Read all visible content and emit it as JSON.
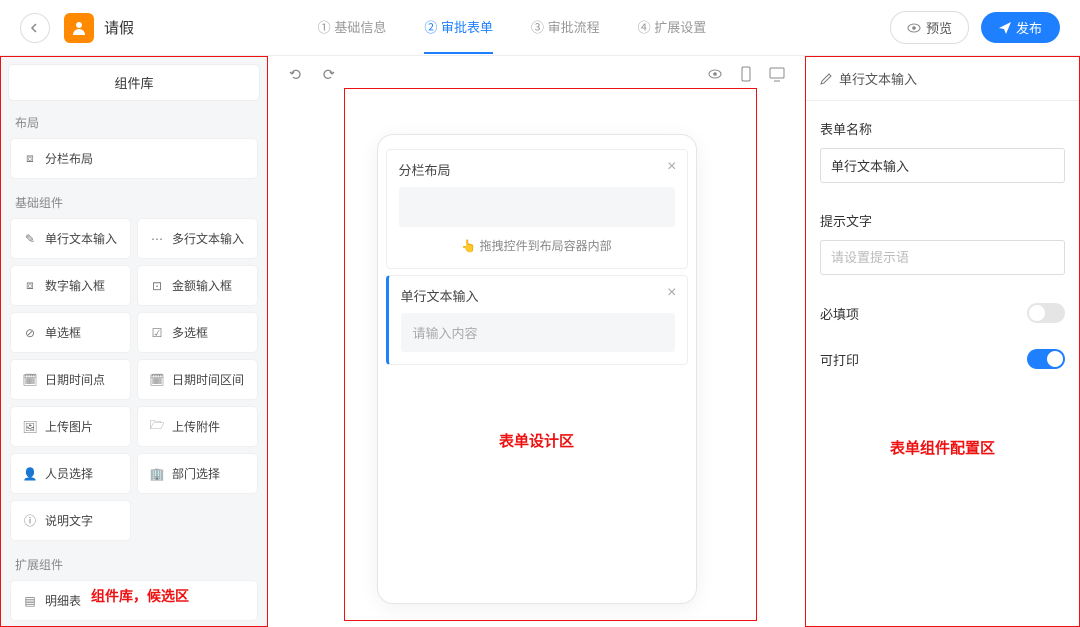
{
  "header": {
    "app_title": "请假",
    "steps": [
      {
        "num": "①",
        "label": "基础信息"
      },
      {
        "num": "②",
        "label": "审批表单"
      },
      {
        "num": "③",
        "label": "审批流程"
      },
      {
        "num": "④",
        "label": "扩展设置"
      }
    ],
    "active_step": 1,
    "preview_label": "预览",
    "publish_label": "发布"
  },
  "library": {
    "title": "组件库",
    "sections": {
      "layout_label": "布局",
      "layout_items": [
        {
          "icon": "⧈",
          "label": "分栏布局"
        }
      ],
      "basic_label": "基础组件",
      "basic_items": [
        {
          "icon": "✎",
          "label": "单行文本输入"
        },
        {
          "icon": "⋯",
          "label": "多行文本输入"
        },
        {
          "icon": "⧈",
          "label": "数字输入框"
        },
        {
          "icon": "⊡",
          "label": "金额输入框"
        },
        {
          "icon": "⊘",
          "label": "单选框"
        },
        {
          "icon": "☑",
          "label": "多选框"
        },
        {
          "icon": "🗓",
          "label": "日期时间点"
        },
        {
          "icon": "🗓",
          "label": "日期时间区间"
        },
        {
          "icon": "🖼",
          "label": "上传图片"
        },
        {
          "icon": "🗁",
          "label": "上传附件"
        },
        {
          "icon": "👤",
          "label": "人员选择"
        },
        {
          "icon": "🏢",
          "label": "部门选择"
        },
        {
          "icon": "ⓘ",
          "label": "说明文字"
        }
      ],
      "expand_label": "扩展组件",
      "expand_items": [
        {
          "icon": "▤",
          "label": "明细表"
        }
      ]
    },
    "annotation": "组件库，候选区"
  },
  "canvas": {
    "layout_card_title": "分栏布局",
    "drop_hint": "拖拽控件到布局容器内部",
    "text_card_title": "单行文本输入",
    "text_placeholder": "请输入内容",
    "annotation": "表单设计区"
  },
  "config": {
    "panel_title": "单行文本输入",
    "name_label": "表单名称",
    "name_value": "单行文本输入",
    "hint_label": "提示文字",
    "hint_placeholder": "请设置提示语",
    "required_label": "必填项",
    "required_on": false,
    "printable_label": "可打印",
    "printable_on": true,
    "annotation": "表单组件配置区"
  }
}
